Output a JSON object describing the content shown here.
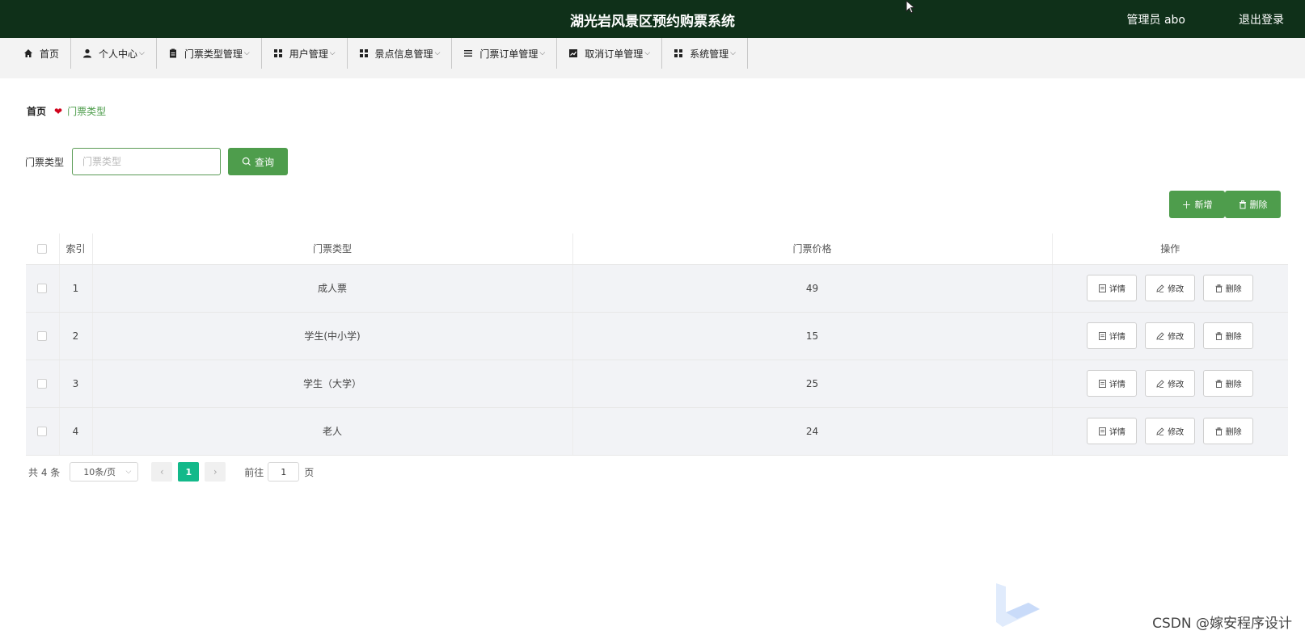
{
  "header": {
    "title": "湖光岩风景区预约购票系统",
    "user": "管理员 abo",
    "logout": "退出登录"
  },
  "nav": {
    "items": [
      {
        "label": "首页",
        "icon": "home-icon",
        "chevron": ""
      },
      {
        "label": "个人中心",
        "icon": "person-icon",
        "chevron": "⌵"
      },
      {
        "label": "门票类型管理",
        "icon": "clipboard-icon",
        "chevron": "⌵"
      },
      {
        "label": "用户管理",
        "icon": "grid-icon",
        "chevron": "⌵"
      },
      {
        "label": "景点信息管理",
        "icon": "grid-icon",
        "chevron": "⌵"
      },
      {
        "label": "门票订单管理",
        "icon": "list-icon",
        "chevron": "⌵"
      },
      {
        "label": "取消订单管理",
        "icon": "chart-icon",
        "chevron": "⌵"
      },
      {
        "label": "系统管理",
        "icon": "grid-icon",
        "chevron": "⌵"
      }
    ]
  },
  "breadcrumb": {
    "home": "首页",
    "current": "门票类型"
  },
  "search": {
    "label": "门票类型",
    "placeholder": "门票类型",
    "button": "查询"
  },
  "actions": {
    "add": "新增",
    "delete": "删除"
  },
  "table": {
    "headers": {
      "index": "索引",
      "type": "门票类型",
      "price": "门票价格",
      "ops": "操作"
    },
    "rows": [
      {
        "index": "1",
        "type": "成人票",
        "price": "49"
      },
      {
        "index": "2",
        "type": "学生(中小学)",
        "price": "15"
      },
      {
        "index": "3",
        "type": "学生（大学）",
        "price": "25"
      },
      {
        "index": "4",
        "type": "老人",
        "price": "24"
      }
    ],
    "row_buttons": {
      "detail": "详情",
      "edit": "修改",
      "delete": "删除"
    }
  },
  "pager": {
    "total": "共 4 条",
    "page_size": "10条/页",
    "prev": "‹",
    "current_page": "1",
    "next": "›",
    "goto_label": "前往",
    "goto_value": "1",
    "page_suffix": "页"
  },
  "watermark": "CSDN @嫁安程序设计",
  "colors": {
    "header_bg": "#0f3019",
    "accent_green": "#4e9d4c",
    "pager_active": "#13b98a"
  }
}
